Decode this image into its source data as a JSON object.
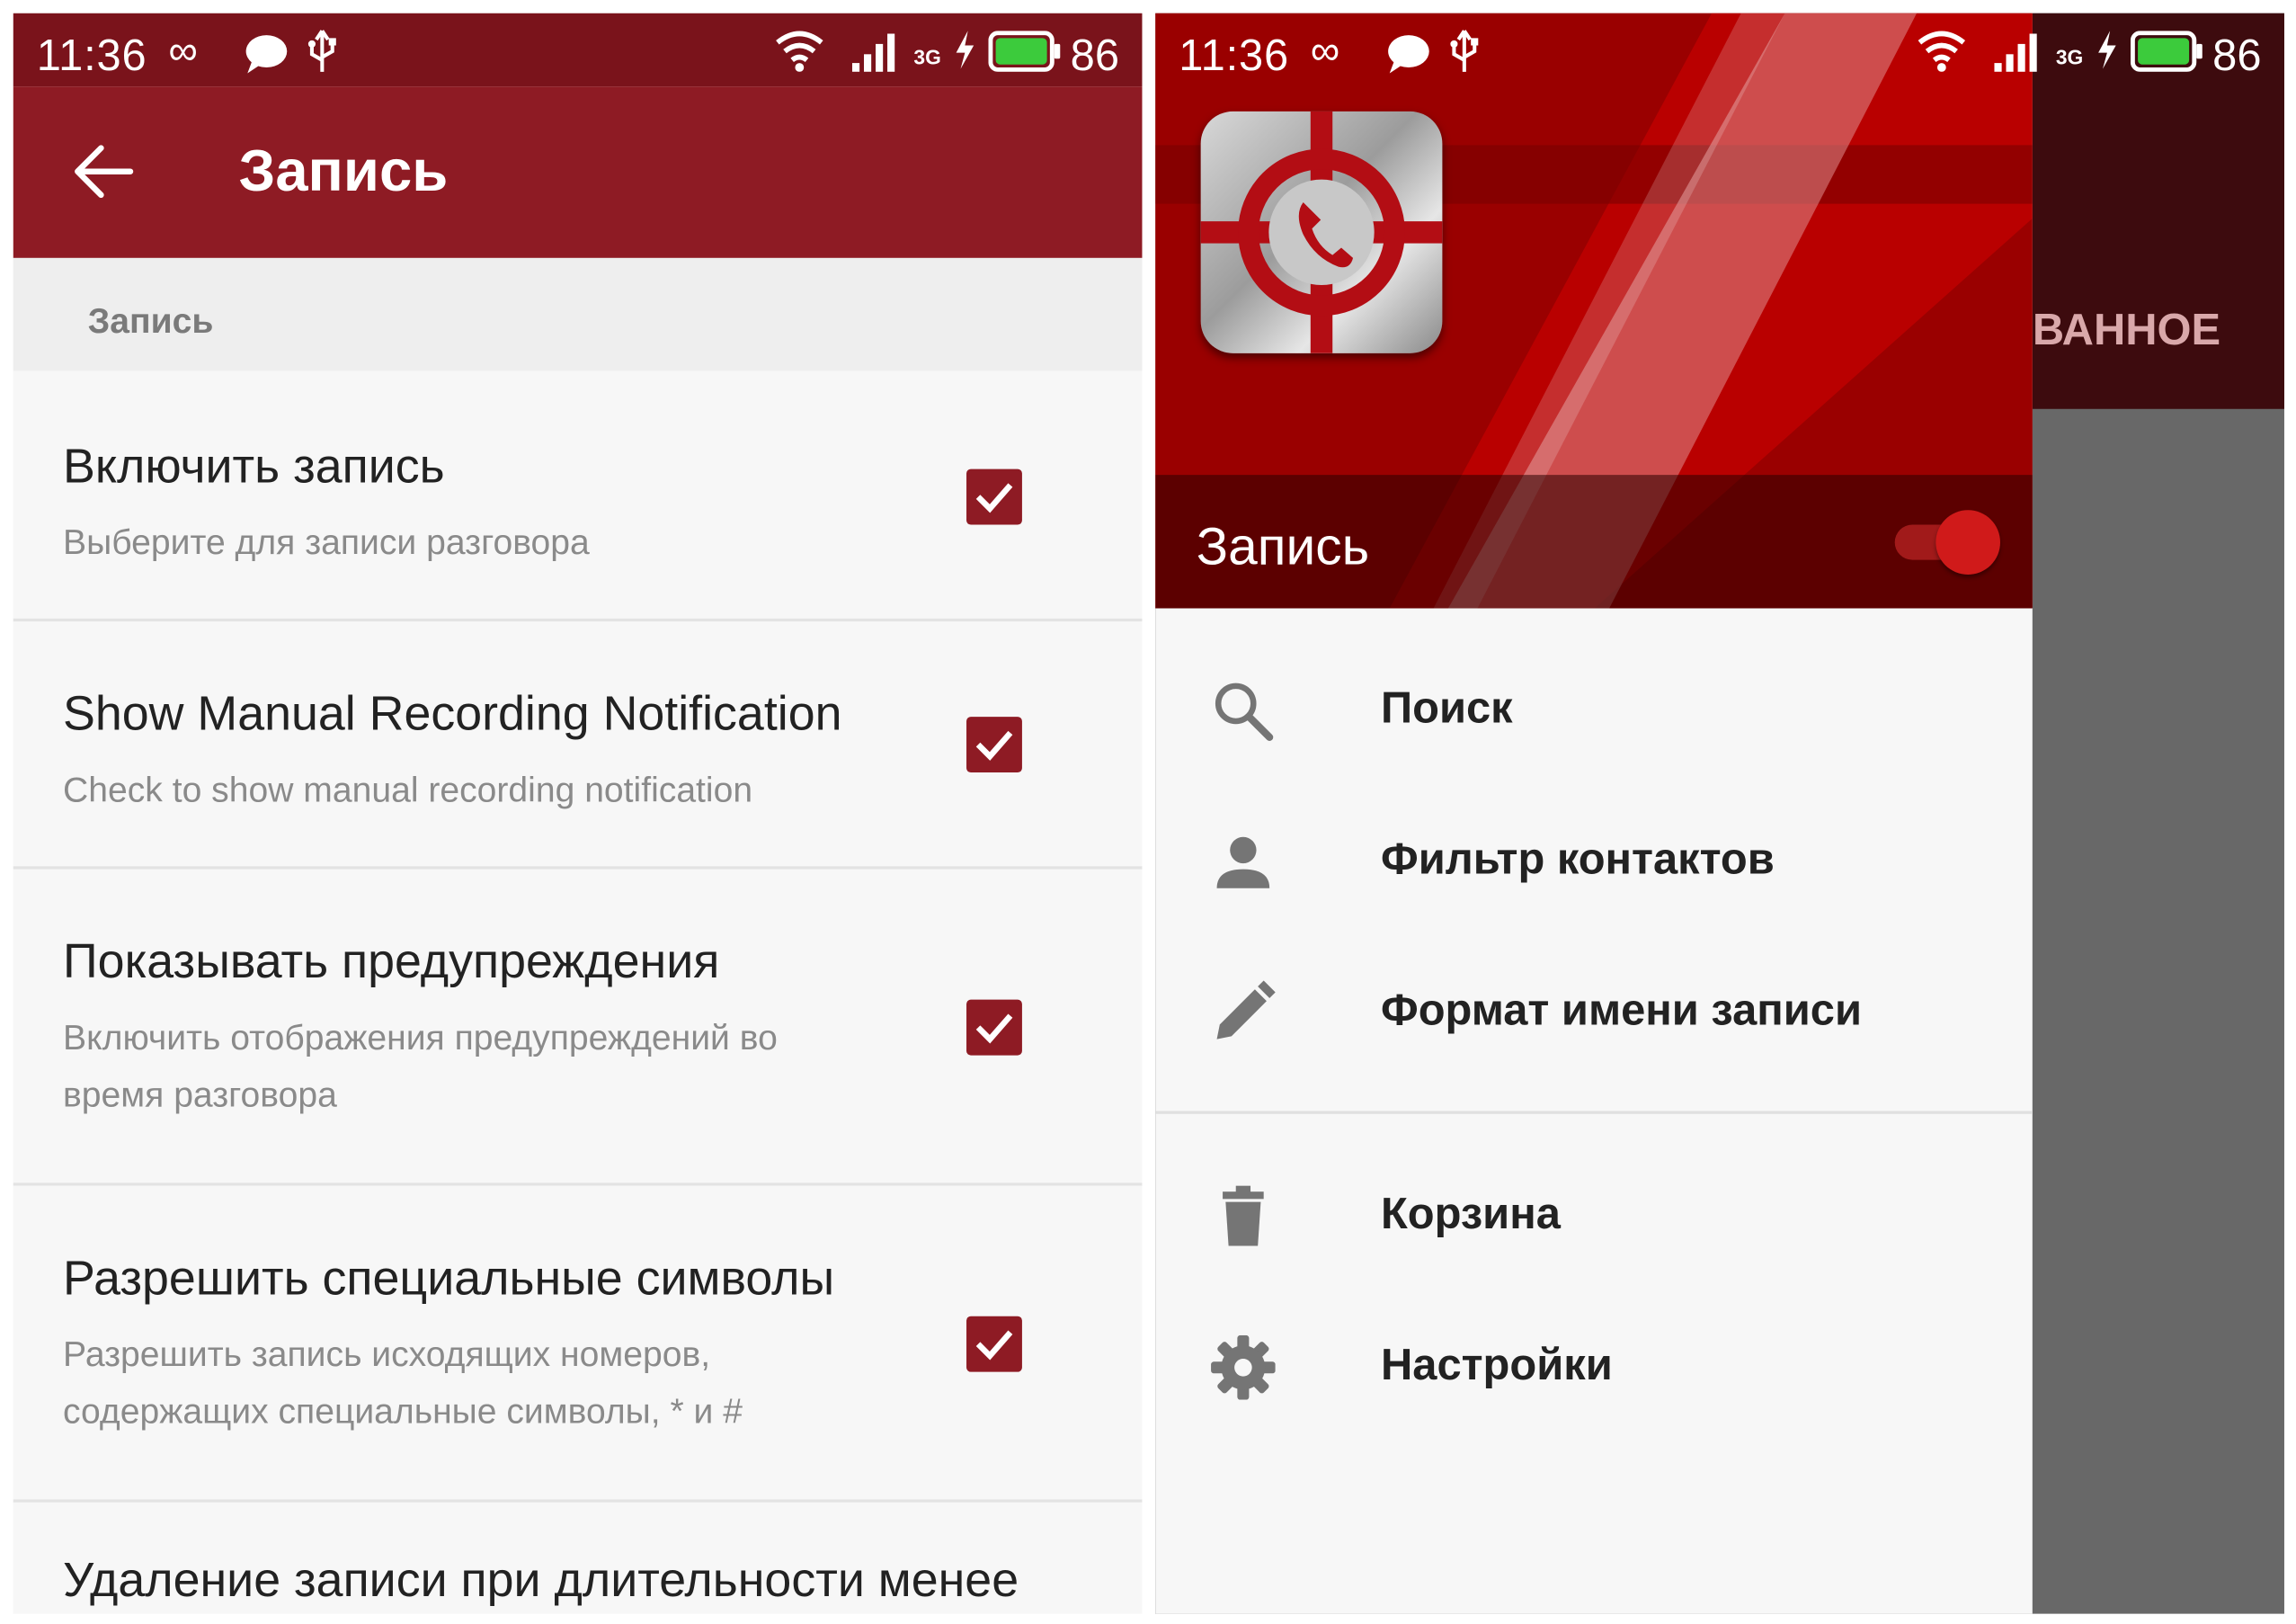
{
  "status_bar": {
    "time": "11:36",
    "network": "3G",
    "battery": "86"
  },
  "left_screen": {
    "toolbar_title": "Запись",
    "section_header": "Запись",
    "preferences": [
      {
        "title": "Включить запись",
        "summary": "Выберите для записи разговора",
        "checked": true
      },
      {
        "title": "Show Manual Recording Notification",
        "summary": "Check to show manual recording notification",
        "checked": true
      },
      {
        "title": "Показывать предупреждения",
        "summary": "Включить отображения предупреждений во время разговора",
        "checked": true
      },
      {
        "title": "Разрешить специальные символы",
        "summary": "Разрешить запись исходящих номеров, содержащих специальные символы, * и #",
        "checked": true
      },
      {
        "title": "Удаление записи при длительности менее",
        "summary": "",
        "checked": false
      }
    ]
  },
  "right_screen": {
    "background_tab_text": "ВАННОЕ",
    "drawer_title": "Запись",
    "toggle_on": true,
    "nav_items": [
      {
        "label": "Поиск",
        "icon": "search-icon"
      },
      {
        "label": "Фильтр контактов",
        "icon": "person-icon"
      },
      {
        "label": "Формат имени записи",
        "icon": "pencil-icon"
      },
      {
        "label": "Корзина",
        "icon": "trash-icon"
      },
      {
        "label": "Настройки",
        "icon": "gear-icon"
      }
    ]
  },
  "colors": {
    "primary": "#8e1b24",
    "status_bar": "#7a131b",
    "accent": "#d01a1a"
  }
}
